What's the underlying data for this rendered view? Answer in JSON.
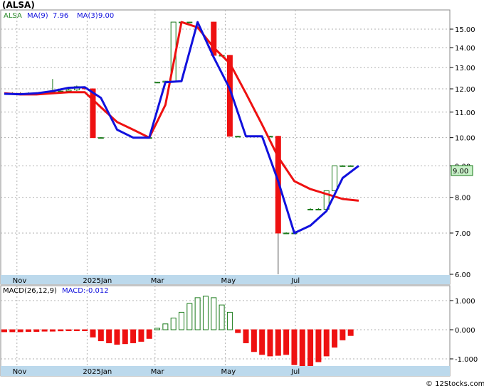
{
  "title": "(ALSA)",
  "watermark": "© 12Stocks.com",
  "legend": {
    "ticker": "ALSA",
    "ma9_label": "MA(9)",
    "ma9_value": "7.96",
    "ma3_label": "MA(3)",
    "ma3_value": "9.00",
    "macd_params": "MACD(26,12,9)",
    "macd_value": "MACD:-0.012"
  },
  "price_badge": "9.00",
  "colors": {
    "up_candle": "#1a7a1a",
    "down_candle": "#ee1111",
    "ma9": "#ee1111",
    "ma3": "#1111dd",
    "macd_pos": "#1a7a1a",
    "macd_neg": "#ee1111",
    "axis_band": "#bcd9ec",
    "grid": "#b0b0b0",
    "badge_bg": "#c8f0c8",
    "legend_ticker": "#2a8a2a",
    "legend_ma": "#1111dd"
  },
  "chart_data": [
    {
      "type": "candlestick",
      "scale": "log",
      "ylim": [
        6.0,
        15.8
      ],
      "y_ticks": [
        "15.00",
        "14.00",
        "13.00",
        "12.00",
        "11.00",
        "10.00",
        "9.00",
        "8.00",
        "7.00",
        "6.00"
      ],
      "x_labels": [
        "Nov",
        "2025Jan",
        "Mar",
        "May",
        "Jul"
      ],
      "candles": [
        {
          "date": "2024-10-28",
          "open": 11.78,
          "high": 11.85,
          "low": 11.75,
          "close": 11.78
        },
        {
          "date": "2024-11-04",
          "open": 11.8,
          "high": 11.85,
          "low": 11.76,
          "close": 11.78
        },
        {
          "date": "2024-11-11",
          "open": 11.78,
          "high": 11.85,
          "low": 11.75,
          "close": 11.8
        },
        {
          "date": "2024-11-18",
          "open": 11.8,
          "high": 11.85,
          "low": 11.78,
          "close": 11.82
        },
        {
          "date": "2024-11-25",
          "open": 11.82,
          "high": 11.86,
          "low": 11.8,
          "close": 11.83
        },
        {
          "date": "2024-12-02",
          "open": 11.85,
          "high": 12.45,
          "low": 11.8,
          "close": 11.88
        },
        {
          "date": "2024-12-09",
          "open": 11.88,
          "high": 11.92,
          "low": 11.8,
          "close": 11.9
        },
        {
          "date": "2024-12-16",
          "open": 11.9,
          "high": 12.0,
          "low": 11.85,
          "close": 11.95
        },
        {
          "date": "2024-12-23",
          "open": 11.95,
          "high": 12.15,
          "low": 11.9,
          "close": 12.1
        },
        {
          "date": "2024-12-30",
          "open": 12.05,
          "high": 12.08,
          "low": 11.95,
          "close": 12.0
        },
        {
          "date": "2025-01-06",
          "open": 12.0,
          "high": 12.02,
          "low": 10.0,
          "close": 10.0
        },
        {
          "date": "2025-01-13",
          "open": 10.0,
          "high": 10.02,
          "low": 10.0,
          "close": 10.0
        },
        {
          "date": "2025-02-24",
          "open": 10.0,
          "high": 10.02,
          "low": 10.0,
          "close": 10.0
        },
        {
          "date": "2025-03-03",
          "open": 12.3,
          "high": 12.32,
          "low": 12.28,
          "close": 12.3
        },
        {
          "date": "2025-03-10",
          "open": 12.3,
          "high": 12.36,
          "low": 12.28,
          "close": 12.35
        },
        {
          "date": "2025-03-17",
          "open": 12.35,
          "high": 15.4,
          "low": 12.35,
          "close": 15.4
        },
        {
          "date": "2025-03-24",
          "open": 15.4,
          "high": 15.42,
          "low": 15.38,
          "close": 15.4
        },
        {
          "date": "2025-03-31",
          "open": 15.4,
          "high": 15.42,
          "low": 15.38,
          "close": 15.4
        },
        {
          "date": "2025-04-21",
          "open": 15.4,
          "high": 15.42,
          "low": 13.6,
          "close": 13.6
        },
        {
          "date": "2025-04-28",
          "open": 13.6,
          "high": 13.62,
          "low": 13.55,
          "close": 13.6
        },
        {
          "date": "2025-05-05",
          "open": 13.6,
          "high": 13.62,
          "low": 10.05,
          "close": 10.05
        },
        {
          "date": "2025-05-12",
          "open": 10.05,
          "high": 10.07,
          "low": 10.03,
          "close": 10.05
        },
        {
          "date": "2025-06-09",
          "open": 10.05,
          "high": 10.07,
          "low": 10.03,
          "close": 10.05
        },
        {
          "date": "2025-06-16",
          "open": 10.05,
          "high": 10.07,
          "low": 6.0,
          "close": 7.0
        },
        {
          "date": "2025-06-23",
          "open": 7.0,
          "high": 7.02,
          "low": 6.98,
          "close": 7.0
        },
        {
          "date": "2025-06-30",
          "open": 7.0,
          "high": 7.02,
          "low": 6.98,
          "close": 7.0
        },
        {
          "date": "2025-07-14",
          "open": 7.65,
          "high": 7.68,
          "low": 7.62,
          "close": 7.65
        },
        {
          "date": "2025-07-21",
          "open": 7.65,
          "high": 7.68,
          "low": 7.62,
          "close": 7.65
        },
        {
          "date": "2025-07-28",
          "open": 7.65,
          "high": 8.2,
          "low": 7.65,
          "close": 8.2
        },
        {
          "date": "2025-08-04",
          "open": 8.2,
          "high": 9.0,
          "low": 8.2,
          "close": 9.0
        },
        {
          "date": "2025-08-11",
          "open": 9.0,
          "high": 9.02,
          "low": 8.98,
          "close": 9.0
        },
        {
          "date": "2025-08-18",
          "open": 9.0,
          "high": 9.02,
          "low": 8.98,
          "close": 9.0
        }
      ],
      "series": [
        {
          "name": "MA(9)",
          "x": [
            "2024-10-21",
            "2024-11-04",
            "2024-11-18",
            "2024-12-02",
            "2024-12-16",
            "2024-12-30",
            "2025-01-13",
            "2025-01-27",
            "2025-02-10",
            "2025-02-24",
            "2025-03-10",
            "2025-03-24",
            "2025-04-07",
            "2025-04-21",
            "2025-05-05",
            "2025-05-19",
            "2025-06-02",
            "2025-06-16",
            "2025-06-30",
            "2025-07-14",
            "2025-07-28",
            "2025-08-11",
            "2025-08-25"
          ],
          "values": [
            11.8,
            11.75,
            11.75,
            11.8,
            11.85,
            11.85,
            11.2,
            10.6,
            10.3,
            10.0,
            11.3,
            15.4,
            15.1,
            14.0,
            13.2,
            11.8,
            10.5,
            9.3,
            8.5,
            8.25,
            8.1,
            7.95,
            7.9
          ]
        },
        {
          "name": "MA(3)",
          "x": [
            "2024-10-21",
            "2024-11-04",
            "2024-11-18",
            "2024-12-02",
            "2024-12-16",
            "2024-12-30",
            "2025-01-13",
            "2025-01-27",
            "2025-02-10",
            "2025-02-24",
            "2025-03-10",
            "2025-03-24",
            "2025-04-07",
            "2025-04-21",
            "2025-05-05",
            "2025-05-19",
            "2025-06-02",
            "2025-06-16",
            "2025-06-30",
            "2025-07-14",
            "2025-07-28",
            "2025-08-11",
            "2025-08-25"
          ],
          "values": [
            11.78,
            11.76,
            11.8,
            11.9,
            12.05,
            12.07,
            11.6,
            10.3,
            10.0,
            10.0,
            12.3,
            12.35,
            15.4,
            13.5,
            12.0,
            10.05,
            10.05,
            8.5,
            7.0,
            7.2,
            7.6,
            8.6,
            9.0
          ]
        }
      ]
    },
    {
      "type": "bar",
      "title": "MACD(26,12,9)",
      "ylim": [
        -1.3,
        1.3
      ],
      "y_ticks": [
        "1.000",
        "0.000",
        "-1.000"
      ],
      "x_labels": [
        "Nov",
        "2025Jan",
        "Mar",
        "May",
        "Jul"
      ],
      "x": [
        "2024-10-21",
        "2024-10-28",
        "2024-11-04",
        "2024-11-11",
        "2024-11-18",
        "2024-11-25",
        "2024-12-02",
        "2024-12-09",
        "2024-12-16",
        "2024-12-23",
        "2024-12-30",
        "2025-01-06",
        "2025-01-13",
        "2025-01-20",
        "2025-01-27",
        "2025-02-03",
        "2025-02-10",
        "2025-02-17",
        "2025-02-24",
        "2025-03-03",
        "2025-03-10",
        "2025-03-17",
        "2025-03-24",
        "2025-03-31",
        "2025-04-07",
        "2025-04-14",
        "2025-04-21",
        "2025-04-28",
        "2025-05-05",
        "2025-05-12",
        "2025-05-19",
        "2025-05-26",
        "2025-06-02",
        "2025-06-09",
        "2025-06-16",
        "2025-06-23",
        "2025-06-30",
        "2025-07-07",
        "2025-07-14",
        "2025-07-21",
        "2025-07-28",
        "2025-08-04",
        "2025-08-11",
        "2025-08-18"
      ],
      "values": [
        -0.07,
        -0.07,
        -0.07,
        -0.06,
        -0.06,
        -0.05,
        -0.05,
        -0.04,
        -0.03,
        -0.02,
        -0.01,
        -0.25,
        -0.38,
        -0.45,
        -0.5,
        -0.48,
        -0.45,
        -0.4,
        -0.3,
        0.05,
        0.2,
        0.4,
        0.6,
        0.9,
        1.1,
        1.15,
        1.1,
        0.85,
        0.6,
        -0.1,
        -0.45,
        -0.75,
        -0.85,
        -0.9,
        -0.88,
        -0.85,
        -1.2,
        -1.25,
        -1.3,
        -1.1,
        -0.9,
        -0.6,
        -0.35,
        -0.2
      ]
    }
  ]
}
